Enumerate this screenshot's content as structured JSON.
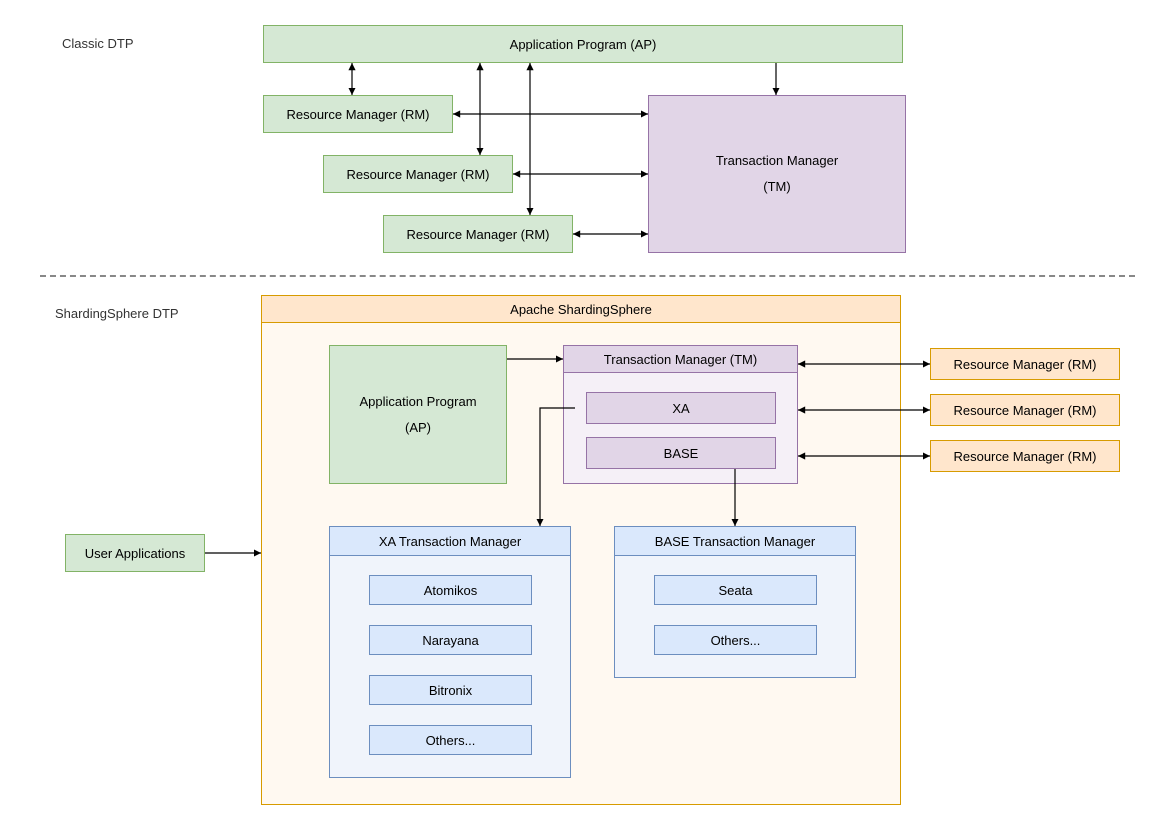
{
  "classic": {
    "title": "Classic DTP",
    "ap": "Application Program (AP)",
    "rm1": "Resource Manager (RM)",
    "rm2": "Resource Manager (RM)",
    "rm3": "Resource Manager (RM)",
    "tm_line1": "Transaction Manager",
    "tm_line2": "(TM)"
  },
  "shardingsphere": {
    "title": "ShardingSphere DTP",
    "container_title": "Apache ShardingSphere",
    "user_apps": "User Applications",
    "ap_line1": "Application Program",
    "ap_line2": "(AP)",
    "tm_title": "Transaction Manager (TM)",
    "xa": "XA",
    "base": "BASE",
    "rm1": "Resource Manager (RM)",
    "rm2": "Resource Manager (RM)",
    "rm3": "Resource Manager (RM)",
    "xa_mgr_title": "XA Transaction Manager",
    "xa_items": {
      "atomikos": "Atomikos",
      "narayana": "Narayana",
      "bitronix": "Bitronix",
      "others": "Others..."
    },
    "base_mgr_title": "BASE Transaction Manager",
    "base_items": {
      "seata": "Seata",
      "others": "Others..."
    }
  }
}
